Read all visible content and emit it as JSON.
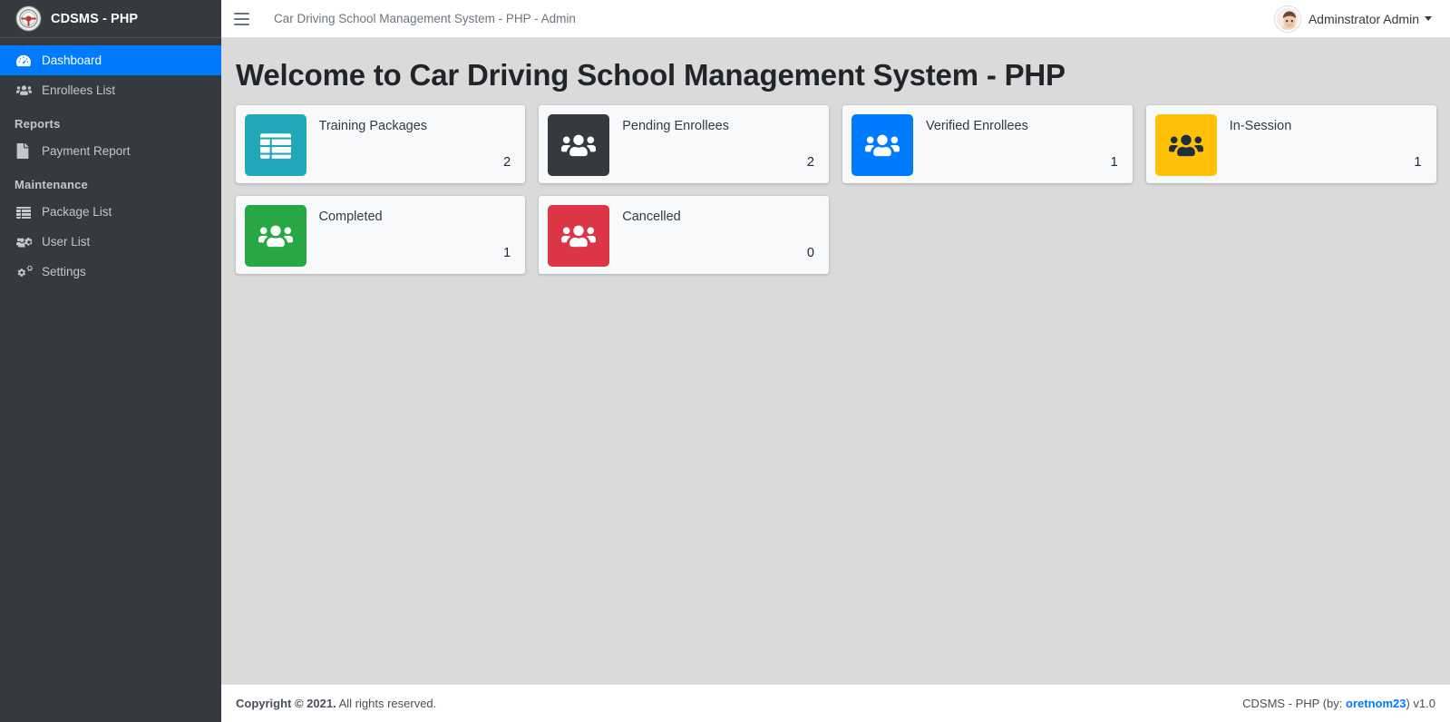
{
  "brand": {
    "text": "CDSMS - PHP",
    "logo_icon": "steering-wheel-logo"
  },
  "sidebar": {
    "items": [
      {
        "label": "Dashboard",
        "icon": "tachometer-icon",
        "active": true
      },
      {
        "label": "Enrollees List",
        "icon": "users-icon",
        "active": false
      }
    ],
    "sections": [
      {
        "header": "Reports",
        "items": [
          {
            "label": "Payment Report",
            "icon": "file-icon",
            "active": false
          }
        ]
      },
      {
        "header": "Maintenance",
        "items": [
          {
            "label": "Package List",
            "icon": "table-list-icon",
            "active": false
          },
          {
            "label": "User List",
            "icon": "users-cog-icon",
            "active": false
          },
          {
            "label": "Settings",
            "icon": "cogs-icon",
            "active": false
          }
        ]
      }
    ]
  },
  "topbar": {
    "menu_icon": "hamburger-icon",
    "title": "Car Driving School Management System - PHP - Admin",
    "user_name": "Adminstrator Admin",
    "avatar_icon": "user-avatar",
    "caret_icon": "caret-down-icon"
  },
  "page": {
    "title": "Welcome to Car Driving School Management System - PHP"
  },
  "cards": [
    {
      "label": "Training Packages",
      "count": "2",
      "color": "#20a8b8",
      "icon": "table-list-icon",
      "icon_color": "#ffffff"
    },
    {
      "label": "Pending Enrollees",
      "count": "2",
      "color": "#343a40",
      "icon": "users-icon",
      "icon_color": "#ffffff"
    },
    {
      "label": "Verified Enrollees",
      "count": "1",
      "color": "#007bff",
      "icon": "users-icon",
      "icon_color": "#ffffff"
    },
    {
      "label": "In-Session",
      "count": "1",
      "color": "#ffc107",
      "icon": "users-icon",
      "icon_color": "#1f2d3d"
    },
    {
      "label": "Completed",
      "count": "1",
      "color": "#28a745",
      "icon": "users-icon",
      "icon_color": "#ffffff"
    },
    {
      "label": "Cancelled",
      "count": "0",
      "color": "#dc3545",
      "icon": "users-icon",
      "icon_color": "#ffffff"
    }
  ],
  "footer": {
    "copyright_strong": "Copyright © 2021.",
    "copyright_rest": " All rights reserved.",
    "right_prefix": "CDSMS - PHP (by: ",
    "right_link": "oretnom23",
    "right_suffix": ") v1.0"
  },
  "colors": {
    "sidebar_bg": "#343a40",
    "accent_blue": "#007bff",
    "content_bg": "#dadada",
    "card_bg": "#f8f9fa"
  }
}
